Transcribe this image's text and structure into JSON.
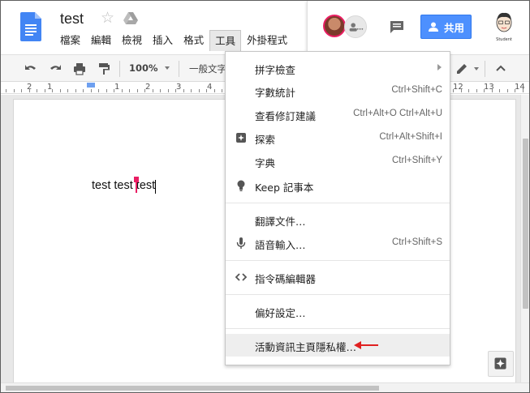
{
  "document": {
    "title": "test",
    "body_text": "test test test"
  },
  "menubar": {
    "items": [
      "檔案",
      "編輯",
      "檢視",
      "插入",
      "格式",
      "工具",
      "外掛程式"
    ],
    "active": "工具"
  },
  "header": {
    "share_label": "共用",
    "user_caption": "Student"
  },
  "toolbar": {
    "zoom": "100%",
    "style": "一般文字"
  },
  "ruler": {
    "left_numbers": [
      "2",
      "1",
      "1",
      "2",
      "3",
      "4"
    ],
    "right_numbers": [
      "12",
      "13",
      "14"
    ]
  },
  "tools_menu": {
    "groups": [
      [
        {
          "label": "拼字檢查",
          "shortcut": "",
          "submenu": true,
          "icon": ""
        },
        {
          "label": "字數統計",
          "shortcut": "Ctrl+Shift+C",
          "submenu": false,
          "icon": ""
        },
        {
          "label": "查看修訂建議",
          "shortcut": "Ctrl+Alt+O Ctrl+Alt+U",
          "submenu": false,
          "icon": ""
        },
        {
          "label": "探索",
          "shortcut": "Ctrl+Alt+Shift+I",
          "submenu": false,
          "icon": "explore-icon"
        },
        {
          "label": "字典",
          "shortcut": "Ctrl+Shift+Y",
          "submenu": false,
          "icon": ""
        },
        {
          "label": "Keep 記事本",
          "shortcut": "",
          "submenu": false,
          "icon": "lightbulb-icon"
        }
      ],
      [
        {
          "label": "翻譯文件…",
          "shortcut": "",
          "submenu": false,
          "icon": ""
        },
        {
          "label": "語音輸入…",
          "shortcut": "Ctrl+Shift+S",
          "submenu": false,
          "icon": "microphone-icon"
        }
      ],
      [
        {
          "label": "指令碼編輯器",
          "shortcut": "",
          "submenu": false,
          "icon": "code-icon"
        }
      ],
      [
        {
          "label": "偏好設定…",
          "shortcut": "",
          "submenu": false,
          "icon": ""
        }
      ],
      [
        {
          "label": "活動資訊主頁隱私權…",
          "shortcut": "",
          "submenu": false,
          "icon": "",
          "highlighted": true
        }
      ]
    ]
  },
  "colors": {
    "share_button": "#4d90fe",
    "collaborator_cursor": "#e91e63",
    "annotation_arrow": "#e02020",
    "docs_blue": "#4285f4"
  }
}
